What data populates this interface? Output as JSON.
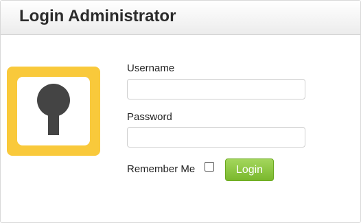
{
  "header": {
    "title": "Login Administrator"
  },
  "logo": {
    "icon": "keyhole-icon",
    "frame_color": "#f9c93b",
    "keyhole_color": "#444444"
  },
  "form": {
    "username_label": "Username",
    "username_value": "",
    "password_label": "Password",
    "password_value": "",
    "remember_label": "Remember Me",
    "remember_checked": false,
    "login_label": "Login"
  },
  "colors": {
    "login_button": "#8cc63f"
  }
}
